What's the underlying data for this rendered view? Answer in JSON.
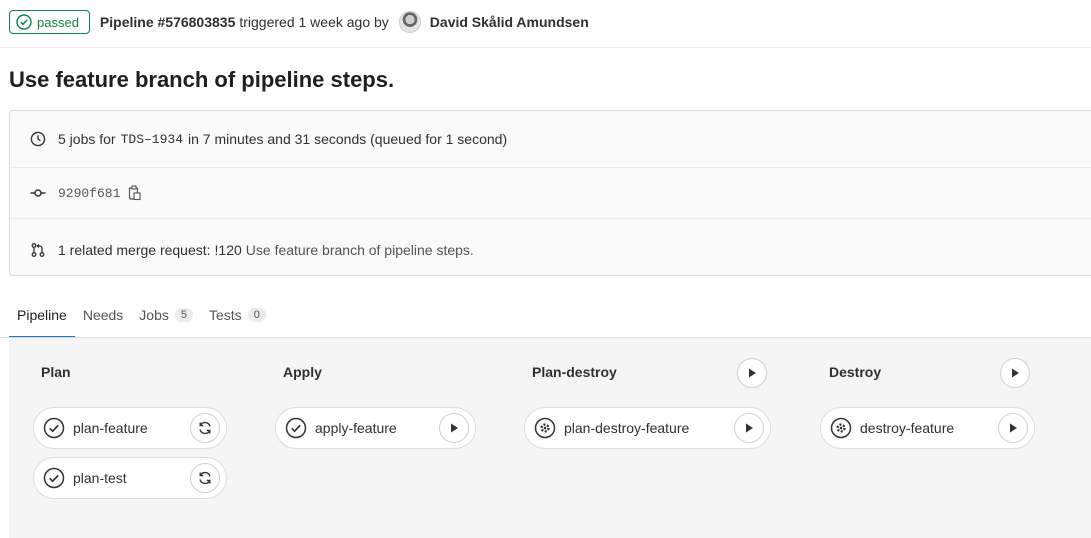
{
  "header": {
    "status": "passed",
    "pipeline_id": "Pipeline #576803835",
    "trigger_text": "triggered 1 week ago by",
    "author": "David Skålid Amundsen"
  },
  "title": "Use feature branch of pipeline steps.",
  "info": {
    "jobs_prefix": "5 jobs for",
    "branch": "TDS–1934",
    "duration_text": "in 7 minutes and 31 seconds (queued for 1 second)",
    "commit_sha": "9290f681",
    "mr_prefix": "1 related merge request:",
    "mr_link": "!120",
    "mr_title": "Use feature branch of pipeline steps."
  },
  "tabs": [
    {
      "label": "Pipeline",
      "count": null
    },
    {
      "label": "Needs",
      "count": null
    },
    {
      "label": "Jobs",
      "count": "5"
    },
    {
      "label": "Tests",
      "count": "0"
    }
  ],
  "stages": [
    {
      "name": "Plan",
      "jobs": [
        {
          "name": "plan-feature",
          "status": "success",
          "action": "retry"
        },
        {
          "name": "plan-test",
          "status": "success",
          "action": "retry"
        }
      ]
    },
    {
      "name": "Apply",
      "jobs": [
        {
          "name": "apply-feature",
          "status": "success",
          "action": "play"
        }
      ]
    },
    {
      "name": "Plan-destroy",
      "jobs": [
        {
          "name": "plan-destroy-feature",
          "status": "manual",
          "action": "play"
        }
      ]
    },
    {
      "name": "Destroy",
      "jobs": [
        {
          "name": "destroy-feature",
          "status": "manual",
          "action": "play"
        }
      ]
    }
  ],
  "colors": {
    "success": "#108548",
    "accent": "#1f75cb"
  }
}
